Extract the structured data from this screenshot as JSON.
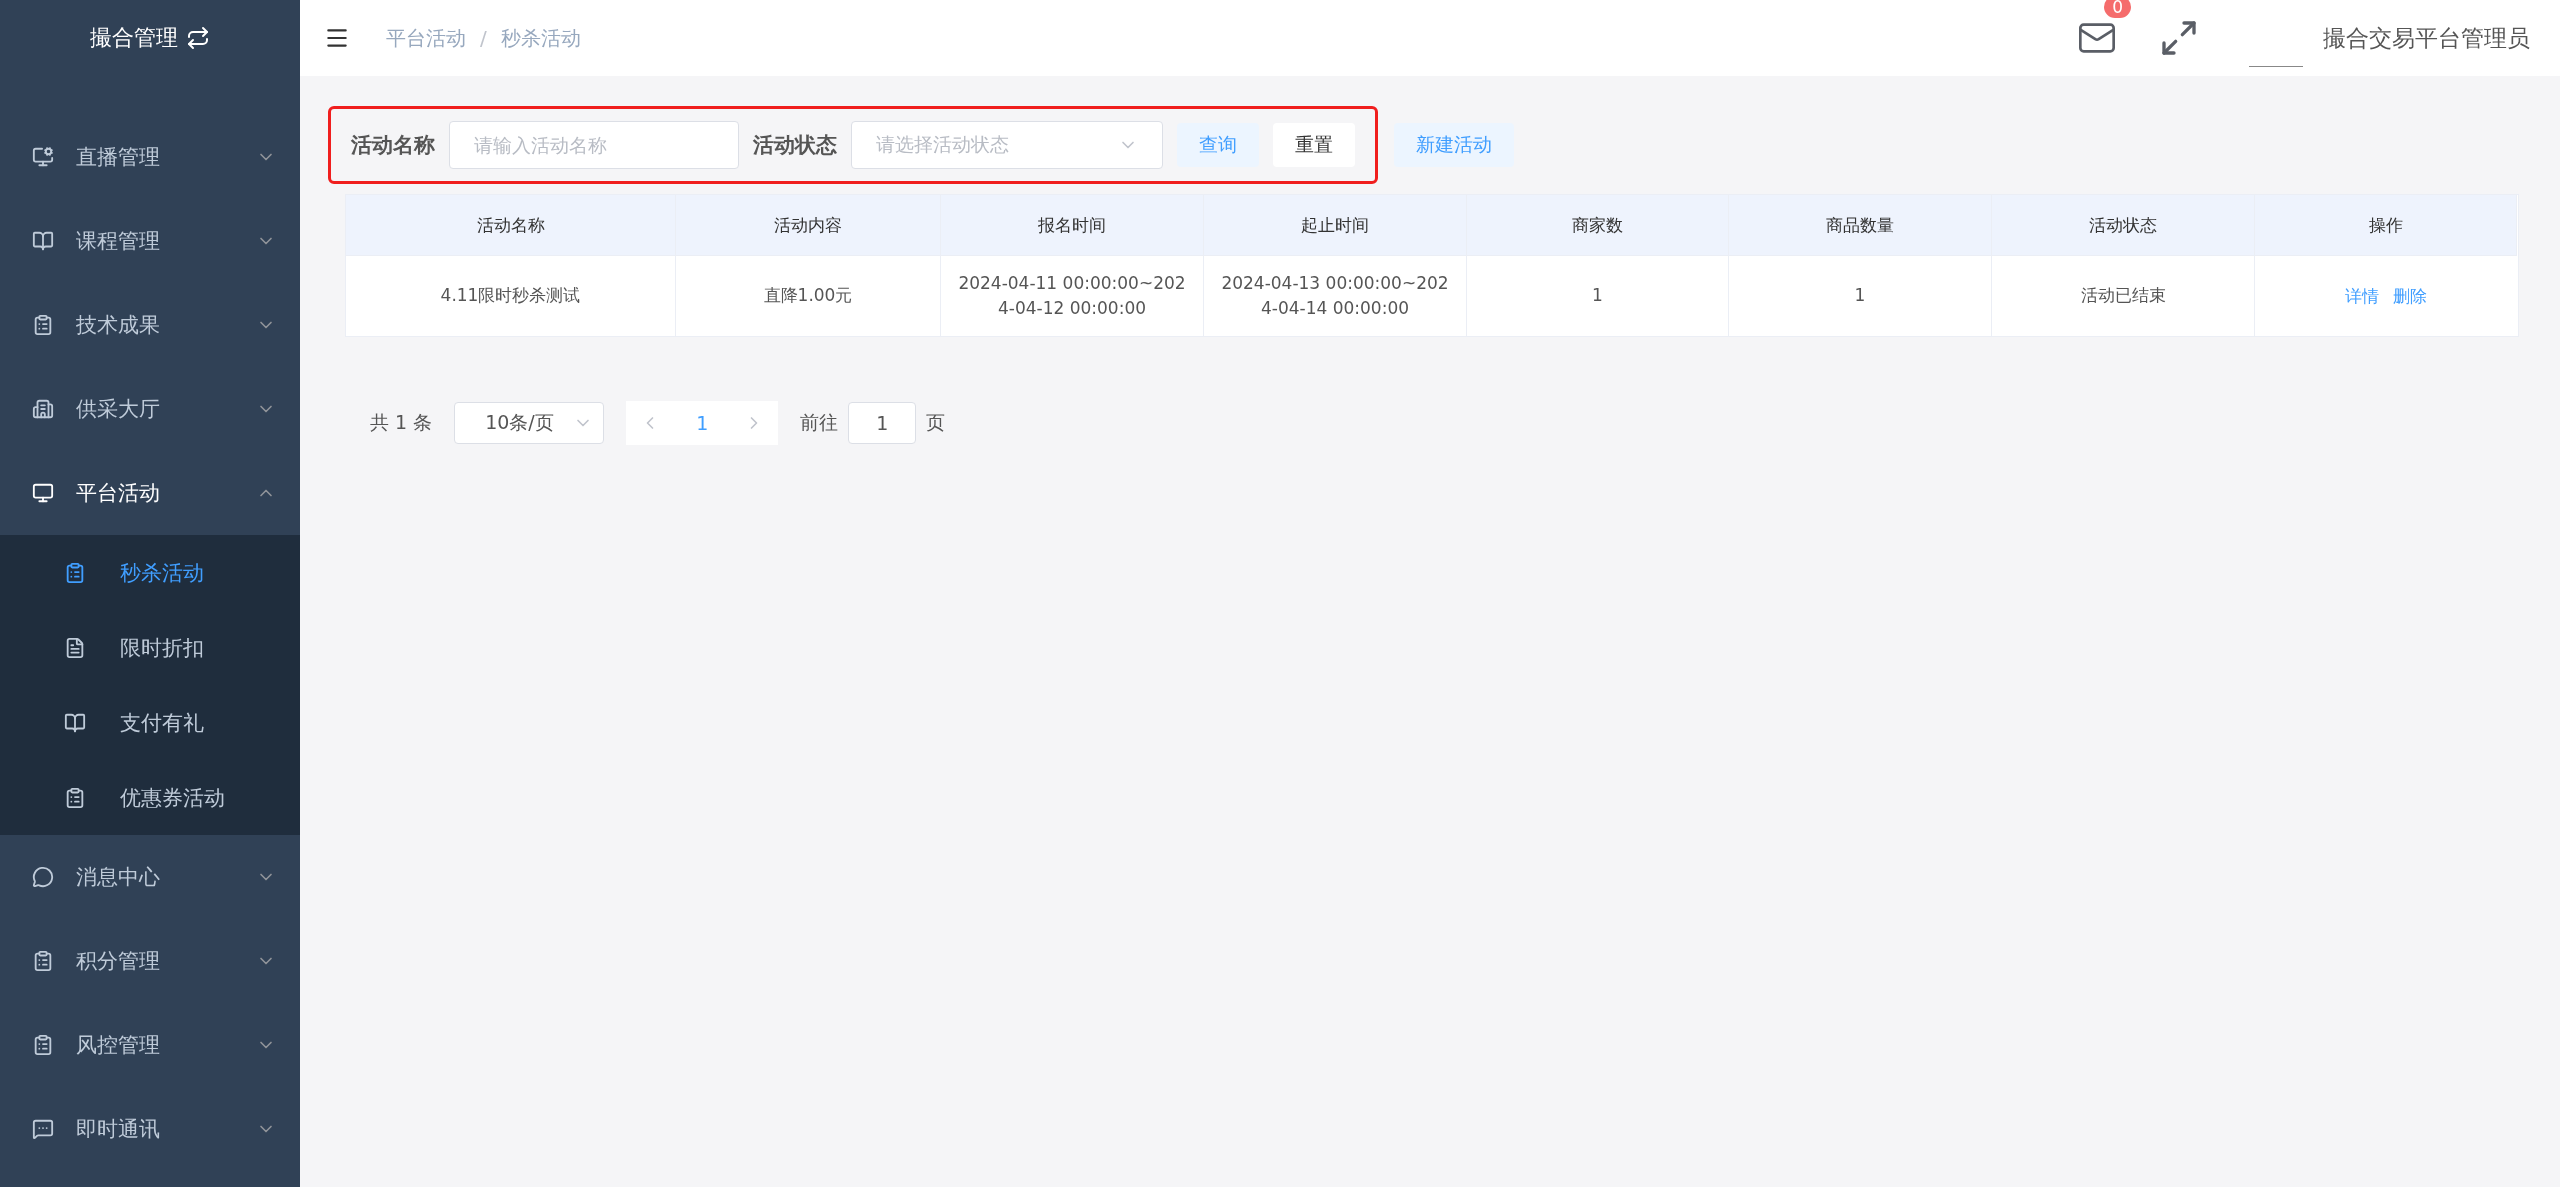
{
  "sidebar": {
    "title": "撮合管理",
    "items": [
      {
        "label": "直播管理",
        "expanded": false
      },
      {
        "label": "课程管理",
        "expanded": false
      },
      {
        "label": "技术成果",
        "expanded": false
      },
      {
        "label": "供采大厅",
        "expanded": false
      },
      {
        "label": "平台活动",
        "expanded": true,
        "children": [
          {
            "label": "秒杀活动",
            "selected": true
          },
          {
            "label": "限时折扣",
            "selected": false
          },
          {
            "label": "支付有礼",
            "selected": false
          },
          {
            "label": "优惠券活动",
            "selected": false
          }
        ]
      },
      {
        "label": "消息中心",
        "expanded": false
      },
      {
        "label": "积分管理",
        "expanded": false
      },
      {
        "label": "风控管理",
        "expanded": false
      },
      {
        "label": "即时通讯",
        "expanded": false
      }
    ]
  },
  "header": {
    "breadcrumb": [
      "平台活动",
      "秒杀活动"
    ],
    "breadcrumb_separator": "/",
    "mail_badge": "0",
    "user": "撮合交易平台管理员"
  },
  "filters": {
    "name_label": "活动名称",
    "name_placeholder": "请输入活动名称",
    "status_label": "活动状态",
    "status_placeholder": "请选择活动状态",
    "search_button": "查询",
    "reset_button": "重置",
    "create_button": "新建活动"
  },
  "table": {
    "columns": [
      "活动名称",
      "活动内容",
      "报名时间",
      "起止时间",
      "商家数",
      "商品数量",
      "活动状态",
      "操作"
    ],
    "rows": [
      {
        "cells": [
          "4.11限时秒杀测试",
          "直降1.00元",
          "2024-04-11 00:00:00~2024-04-12 00:00:00",
          "2024-04-13 00:00:00~2024-04-14 00:00:00",
          "1",
          "1",
          "活动已结束"
        ],
        "actions": [
          "详情",
          "删除"
        ]
      }
    ]
  },
  "pagination": {
    "total": "共 1 条",
    "page_size": "10条/页",
    "pages": [
      {
        "label": "1",
        "selected": true
      }
    ],
    "goto_label": "前往",
    "goto_value": "1",
    "goto_suffix": "页"
  }
}
